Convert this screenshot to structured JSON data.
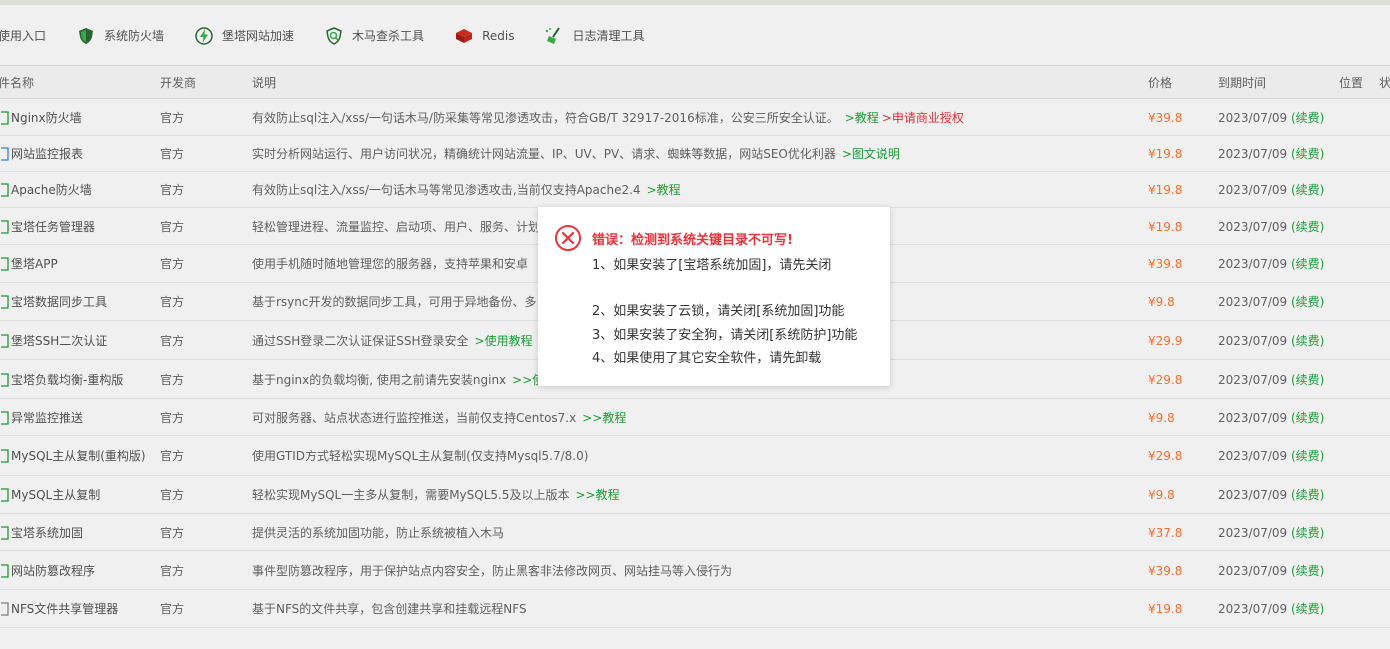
{
  "toolbar": {
    "items": [
      {
        "label": "使用入口",
        "icon": "none"
      },
      {
        "label": "系统防火墙",
        "icon": "shield-icon"
      },
      {
        "label": "堡塔网站加速",
        "icon": "lightning-icon"
      },
      {
        "label": "木马查杀工具",
        "icon": "scan-shield-icon"
      },
      {
        "label": "Redis",
        "icon": "redis-icon"
      },
      {
        "label": "日志清理工具",
        "icon": "broom-icon"
      }
    ]
  },
  "table": {
    "headers": {
      "name": "件名称",
      "developer": "开发商",
      "description": "说明",
      "price": "价格",
      "expiry": "到期时间",
      "position": "位置",
      "status": "状"
    },
    "rows": [
      {
        "name": "Nginx防火墙",
        "developer": "官方",
        "desc": "有效防止sql注入/xss/一句话木马/防采集等常见渗透攻击，符合GB/T 32917-2016标准，公安三所安全认证。",
        "link1": ">教程",
        "link2": ">申请商业授权",
        "price": "¥39.8",
        "expiry": "2023/07/09",
        "renew": "(续费)"
      },
      {
        "name": "网站监控报表",
        "developer": "官方",
        "desc": "实时分析网站运行、用户访问状况，精确统计网站流量、IP、UV、PV、请求、蜘蛛等数据，网站SEO优化利器",
        "link1": ">图文说明",
        "link2": "",
        "price": "¥19.8",
        "expiry": "2023/07/09",
        "renew": "(续费)"
      },
      {
        "name": "Apache防火墙",
        "developer": "官方",
        "desc": "有效防止sql注入/xss/一句话木马等常见渗透攻击,当前仅支持Apache2.4",
        "link1": ">教程",
        "link2": "",
        "price": "¥19.8",
        "expiry": "2023/07/09",
        "renew": "(续费)"
      },
      {
        "name": "宝塔任务管理器",
        "developer": "官方",
        "desc": "轻松管理进程、流量监控、启动项、用户、服务、计划",
        "link1": "",
        "link2": "",
        "price": "¥19.8",
        "expiry": "2023/07/09",
        "renew": "(续费)"
      },
      {
        "name": "堡塔APP",
        "developer": "官方",
        "desc": "使用手机随时随地管理您的服务器，支持苹果和安卓",
        "link1": "",
        "link2": "",
        "price": "¥39.8",
        "expiry": "2023/07/09",
        "renew": "(续费)"
      },
      {
        "name": "宝塔数据同步工具",
        "developer": "官方",
        "desc": "基于rsync开发的数据同步工具，可用于异地备份、多台",
        "link1": "",
        "link2": "",
        "price": "¥9.8",
        "expiry": "2023/07/09",
        "renew": "(续费)"
      },
      {
        "name": "堡塔SSH二次认证",
        "developer": "官方",
        "desc": "通过SSH登录二次认证保证SSH登录安全",
        "link1": ">使用教程",
        "link2": "",
        "price": "¥29.9",
        "expiry": "2023/07/09",
        "renew": "(续费)"
      },
      {
        "name": "宝塔负载均衡-重构版",
        "developer": "官方",
        "desc": "基于nginx的负载均衡, 使用之前请先安装nginx",
        "link1": ">>使",
        "link2": "",
        "price": "¥29.8",
        "expiry": "2023/07/09",
        "renew": "(续费)"
      },
      {
        "name": "异常监控推送",
        "developer": "官方",
        "desc": "可对服务器、站点状态进行监控推送，当前仅支持Centos7.x",
        "link1": ">>教程",
        "link2": "",
        "price": "¥9.8",
        "expiry": "2023/07/09",
        "renew": "(续费)"
      },
      {
        "name": "MySQL主从复制(重构版)",
        "developer": "官方",
        "desc": "使用GTID方式轻松实现MySQL主从复制(仅支持Mysql5.7/8.0)",
        "link1": "",
        "link2": "",
        "price": "¥29.8",
        "expiry": "2023/07/09",
        "renew": "(续费)"
      },
      {
        "name": "MySQL主从复制",
        "developer": "官方",
        "desc": "轻松实现MySQL一主多从复制，需要MySQL5.5及以上版本",
        "link1": ">>教程",
        "link2": "",
        "price": "¥9.8",
        "expiry": "2023/07/09",
        "renew": "(续费)"
      },
      {
        "name": "宝塔系统加固",
        "developer": "官方",
        "desc": "提供灵活的系统加固功能，防止系统被植入木马",
        "link1": "",
        "link2": "",
        "price": "¥37.8",
        "expiry": "2023/07/09",
        "renew": "(续费)"
      },
      {
        "name": "网站防篡改程序",
        "developer": "官方",
        "desc": "事件型防篡改程序，用于保护站点内容安全，防止黑客非法修改网页、网站挂马等入侵行为",
        "link1": "",
        "link2": "",
        "price": "¥39.8",
        "expiry": "2023/07/09",
        "renew": "(续费)"
      },
      {
        "name": "NFS文件共享管理器",
        "developer": "官方",
        "desc": "基于NFS的文件共享，包含创建共享和挂载远程NFS",
        "link1": "",
        "link2": "",
        "price": "¥19.8",
        "expiry": "2023/07/09",
        "renew": "(续费)"
      }
    ]
  },
  "dialog": {
    "title": "错误：检测到系统关键目录不可写!",
    "lines": [
      "1、如果安装了[宝塔系统加固]，请先关闭",
      "2、如果安装了云锁，请关闭[系统加固]功能",
      "3、如果安装了安全狗，请关闭[系统防护]功能",
      "4、如果使用了其它安全软件，请先卸载"
    ],
    "icon": "error-circle-icon"
  },
  "colors": {
    "green": "#20a53a",
    "red": "#e8353c",
    "orange": "#ff7733"
  }
}
